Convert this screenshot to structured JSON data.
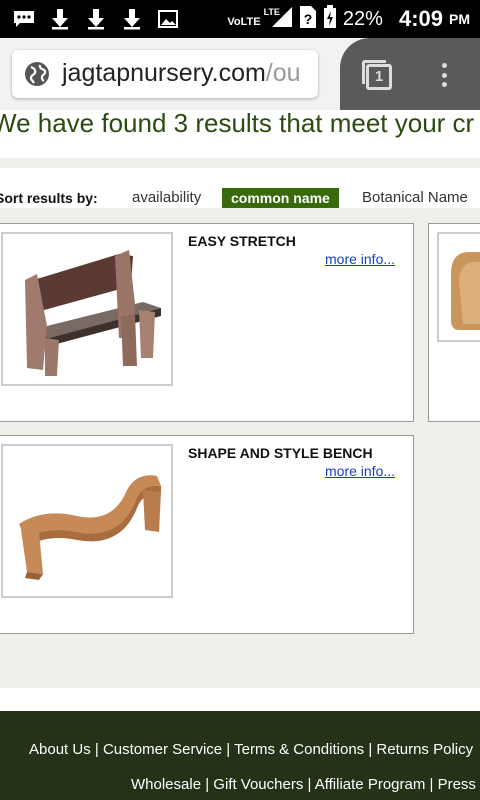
{
  "status_bar": {
    "icons": [
      "message-icon",
      "download-icon",
      "download-icon",
      "download-icon",
      "image-icon"
    ],
    "network": "VoLTE",
    "network_sub": "LTE",
    "battery": "22%",
    "time": "4:09",
    "ampm": "PM"
  },
  "browser": {
    "url_main": "jagtapnursery.com",
    "url_rest": "/ou",
    "tab_count": "1"
  },
  "page": {
    "headline": "We have found 3 results that meet your cr",
    "sort": {
      "label": "Sort results by:",
      "options": [
        "availability",
        "common name",
        "Botanical Name"
      ],
      "active": "common name"
    },
    "products": [
      {
        "name": "EASY STRETCH",
        "link": "more info..."
      },
      {
        "name": "SHAPE AND STYLE BENCH",
        "link": "more info..."
      }
    ]
  },
  "footer": {
    "row1": [
      "About Us",
      "Customer Service",
      "Terms & Conditions",
      "Returns Policy"
    ],
    "row2": [
      "Wholesale",
      "Gift Vouchers",
      "Affiliate Program",
      "Press"
    ]
  },
  "colors": {
    "accent_green": "#386a0b",
    "headline_green": "#2d4a11",
    "footer_bg": "#243218",
    "link_blue": "#1a3fbf"
  }
}
